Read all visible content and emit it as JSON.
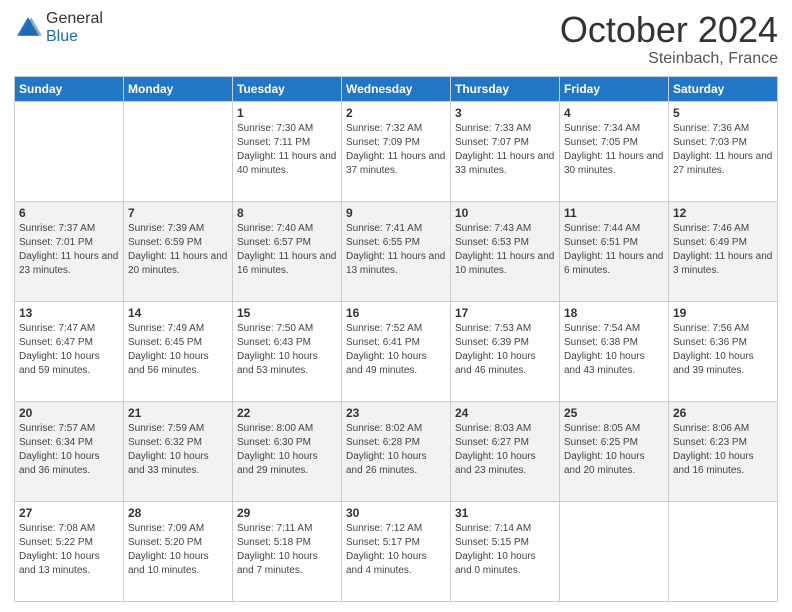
{
  "header": {
    "logo_general": "General",
    "logo_blue": "Blue",
    "title": "October 2024",
    "subtitle": "Steinbach, France"
  },
  "columns": [
    "Sunday",
    "Monday",
    "Tuesday",
    "Wednesday",
    "Thursday",
    "Friday",
    "Saturday"
  ],
  "weeks": [
    [
      {
        "day": "",
        "sunrise": "",
        "sunset": "",
        "daylight": "",
        "empty": true
      },
      {
        "day": "",
        "sunrise": "",
        "sunset": "",
        "daylight": "",
        "empty": true
      },
      {
        "day": "1",
        "sunrise": "Sunrise: 7:30 AM",
        "sunset": "Sunset: 7:11 PM",
        "daylight": "Daylight: 11 hours and 40 minutes."
      },
      {
        "day": "2",
        "sunrise": "Sunrise: 7:32 AM",
        "sunset": "Sunset: 7:09 PM",
        "daylight": "Daylight: 11 hours and 37 minutes."
      },
      {
        "day": "3",
        "sunrise": "Sunrise: 7:33 AM",
        "sunset": "Sunset: 7:07 PM",
        "daylight": "Daylight: 11 hours and 33 minutes."
      },
      {
        "day": "4",
        "sunrise": "Sunrise: 7:34 AM",
        "sunset": "Sunset: 7:05 PM",
        "daylight": "Daylight: 11 hours and 30 minutes."
      },
      {
        "day": "5",
        "sunrise": "Sunrise: 7:36 AM",
        "sunset": "Sunset: 7:03 PM",
        "daylight": "Daylight: 11 hours and 27 minutes."
      }
    ],
    [
      {
        "day": "6",
        "sunrise": "Sunrise: 7:37 AM",
        "sunset": "Sunset: 7:01 PM",
        "daylight": "Daylight: 11 hours and 23 minutes."
      },
      {
        "day": "7",
        "sunrise": "Sunrise: 7:39 AM",
        "sunset": "Sunset: 6:59 PM",
        "daylight": "Daylight: 11 hours and 20 minutes."
      },
      {
        "day": "8",
        "sunrise": "Sunrise: 7:40 AM",
        "sunset": "Sunset: 6:57 PM",
        "daylight": "Daylight: 11 hours and 16 minutes."
      },
      {
        "day": "9",
        "sunrise": "Sunrise: 7:41 AM",
        "sunset": "Sunset: 6:55 PM",
        "daylight": "Daylight: 11 hours and 13 minutes."
      },
      {
        "day": "10",
        "sunrise": "Sunrise: 7:43 AM",
        "sunset": "Sunset: 6:53 PM",
        "daylight": "Daylight: 11 hours and 10 minutes."
      },
      {
        "day": "11",
        "sunrise": "Sunrise: 7:44 AM",
        "sunset": "Sunset: 6:51 PM",
        "daylight": "Daylight: 11 hours and 6 minutes."
      },
      {
        "day": "12",
        "sunrise": "Sunrise: 7:46 AM",
        "sunset": "Sunset: 6:49 PM",
        "daylight": "Daylight: 11 hours and 3 minutes."
      }
    ],
    [
      {
        "day": "13",
        "sunrise": "Sunrise: 7:47 AM",
        "sunset": "Sunset: 6:47 PM",
        "daylight": "Daylight: 10 hours and 59 minutes."
      },
      {
        "day": "14",
        "sunrise": "Sunrise: 7:49 AM",
        "sunset": "Sunset: 6:45 PM",
        "daylight": "Daylight: 10 hours and 56 minutes."
      },
      {
        "day": "15",
        "sunrise": "Sunrise: 7:50 AM",
        "sunset": "Sunset: 6:43 PM",
        "daylight": "Daylight: 10 hours and 53 minutes."
      },
      {
        "day": "16",
        "sunrise": "Sunrise: 7:52 AM",
        "sunset": "Sunset: 6:41 PM",
        "daylight": "Daylight: 10 hours and 49 minutes."
      },
      {
        "day": "17",
        "sunrise": "Sunrise: 7:53 AM",
        "sunset": "Sunset: 6:39 PM",
        "daylight": "Daylight: 10 hours and 46 minutes."
      },
      {
        "day": "18",
        "sunrise": "Sunrise: 7:54 AM",
        "sunset": "Sunset: 6:38 PM",
        "daylight": "Daylight: 10 hours and 43 minutes."
      },
      {
        "day": "19",
        "sunrise": "Sunrise: 7:56 AM",
        "sunset": "Sunset: 6:36 PM",
        "daylight": "Daylight: 10 hours and 39 minutes."
      }
    ],
    [
      {
        "day": "20",
        "sunrise": "Sunrise: 7:57 AM",
        "sunset": "Sunset: 6:34 PM",
        "daylight": "Daylight: 10 hours and 36 minutes."
      },
      {
        "day": "21",
        "sunrise": "Sunrise: 7:59 AM",
        "sunset": "Sunset: 6:32 PM",
        "daylight": "Daylight: 10 hours and 33 minutes."
      },
      {
        "day": "22",
        "sunrise": "Sunrise: 8:00 AM",
        "sunset": "Sunset: 6:30 PM",
        "daylight": "Daylight: 10 hours and 29 minutes."
      },
      {
        "day": "23",
        "sunrise": "Sunrise: 8:02 AM",
        "sunset": "Sunset: 6:28 PM",
        "daylight": "Daylight: 10 hours and 26 minutes."
      },
      {
        "day": "24",
        "sunrise": "Sunrise: 8:03 AM",
        "sunset": "Sunset: 6:27 PM",
        "daylight": "Daylight: 10 hours and 23 minutes."
      },
      {
        "day": "25",
        "sunrise": "Sunrise: 8:05 AM",
        "sunset": "Sunset: 6:25 PM",
        "daylight": "Daylight: 10 hours and 20 minutes."
      },
      {
        "day": "26",
        "sunrise": "Sunrise: 8:06 AM",
        "sunset": "Sunset: 6:23 PM",
        "daylight": "Daylight: 10 hours and 16 minutes."
      }
    ],
    [
      {
        "day": "27",
        "sunrise": "Sunrise: 7:08 AM",
        "sunset": "Sunset: 5:22 PM",
        "daylight": "Daylight: 10 hours and 13 minutes."
      },
      {
        "day": "28",
        "sunrise": "Sunrise: 7:09 AM",
        "sunset": "Sunset: 5:20 PM",
        "daylight": "Daylight: 10 hours and 10 minutes."
      },
      {
        "day": "29",
        "sunrise": "Sunrise: 7:11 AM",
        "sunset": "Sunset: 5:18 PM",
        "daylight": "Daylight: 10 hours and 7 minutes."
      },
      {
        "day": "30",
        "sunrise": "Sunrise: 7:12 AM",
        "sunset": "Sunset: 5:17 PM",
        "daylight": "Daylight: 10 hours and 4 minutes."
      },
      {
        "day": "31",
        "sunrise": "Sunrise: 7:14 AM",
        "sunset": "Sunset: 5:15 PM",
        "daylight": "Daylight: 10 hours and 0 minutes."
      },
      {
        "day": "",
        "sunrise": "",
        "sunset": "",
        "daylight": "",
        "empty": true
      },
      {
        "day": "",
        "sunrise": "",
        "sunset": "",
        "daylight": "",
        "empty": true
      }
    ]
  ]
}
